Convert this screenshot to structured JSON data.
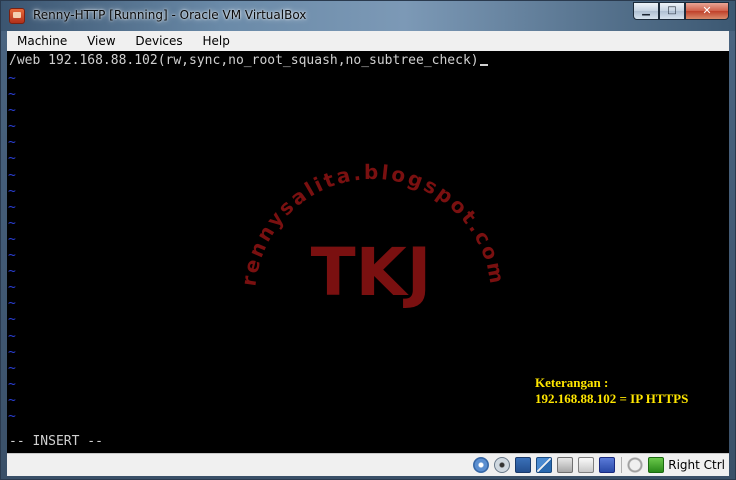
{
  "window": {
    "title": "Renny-HTTP [Running] - Oracle VM VirtualBox",
    "minimize_glyph": "▁",
    "maximize_glyph": "□",
    "close_glyph": "✕"
  },
  "menu": {
    "items": [
      "Machine",
      "View",
      "Devices",
      "Help"
    ]
  },
  "terminal": {
    "first_line": "/web 192.168.88.102(rw,sync,no_root_squash,no_subtree_check)",
    "empty_line_marker": "~",
    "mode_line": "-- INSERT --"
  },
  "watermark": {
    "arc_text": "rennysalita.blogspot.com",
    "center_text": "TKJ"
  },
  "annotation": {
    "heading": "Keterangan :",
    "body": "192.168.88.102 = IP HTTPS"
  },
  "statusbar": {
    "icons": [
      "hard-disk-icon",
      "optical-drive-icon",
      "floppy-icon",
      "network-icon",
      "usb-icon",
      "shared-folders-icon",
      "virtualization-icon",
      "mouse-integration-icon"
    ],
    "host_key_label": "Right Ctrl"
  },
  "colors": {
    "tilde": "#2a3fd6",
    "annotation": "#ffe600",
    "watermark": "#7a1010"
  }
}
